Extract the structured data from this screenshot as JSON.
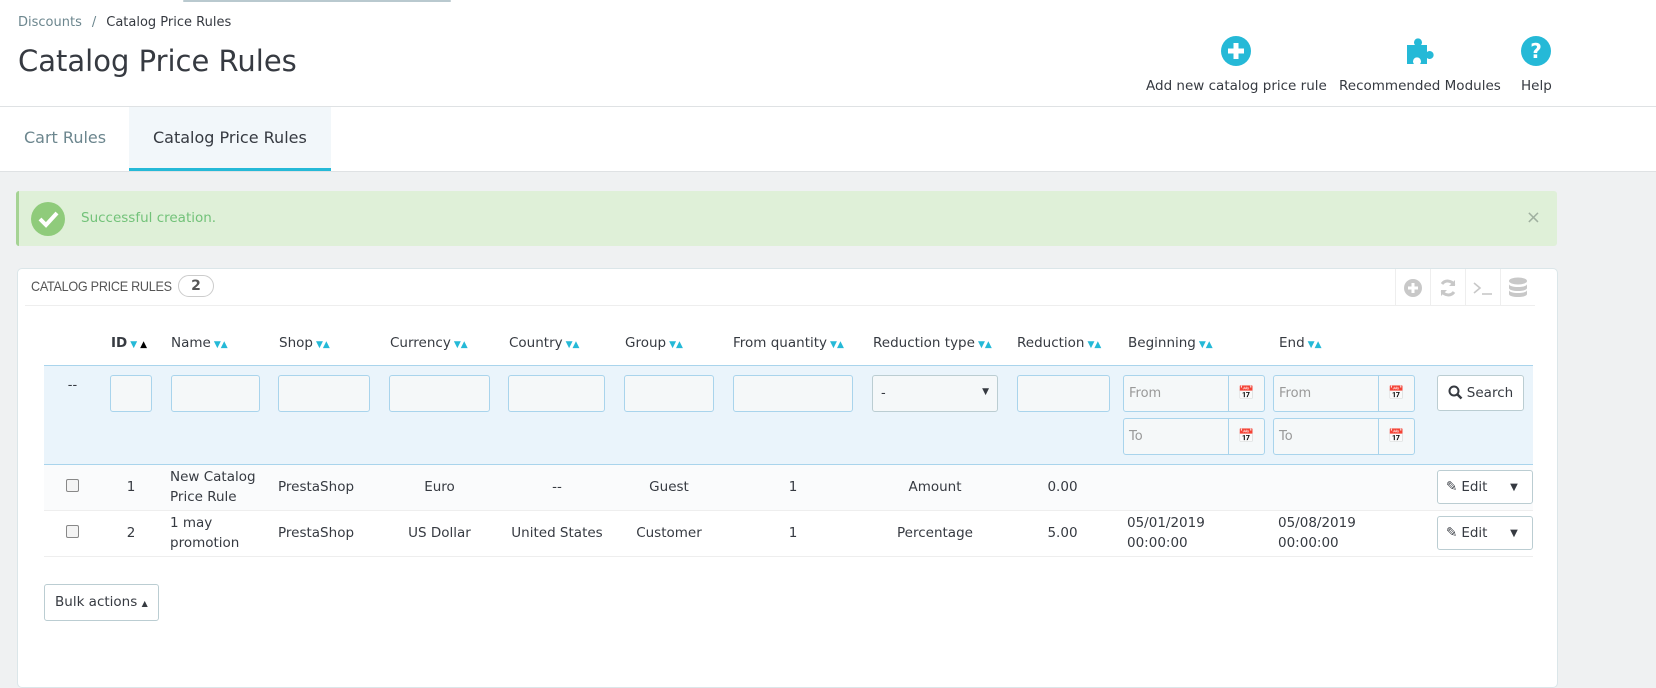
{
  "breadcrumb": {
    "parent": "Discounts",
    "separator": "/",
    "current": "Catalog Price Rules"
  },
  "page_title": "Catalog Price Rules",
  "toolbar": {
    "add": "Add new catalog price rule",
    "modules": "Recommended Modules",
    "help": "Help"
  },
  "tabs": [
    {
      "label": "Cart Rules"
    },
    {
      "label": "Catalog Price Rules",
      "active": true
    }
  ],
  "alert": {
    "message": "Successful creation.",
    "close": "×"
  },
  "panel": {
    "title": "CATALOG PRICE RULES",
    "count": "2"
  },
  "columns": [
    "ID",
    "Name",
    "Shop",
    "Currency",
    "Country",
    "Group",
    "From quantity",
    "Reduction type",
    "Reduction",
    "Beginning",
    "End"
  ],
  "filters": {
    "dash": "--",
    "reduction_type": "-",
    "from": "From",
    "to": "To",
    "search": "Search"
  },
  "rows": [
    {
      "id": "1",
      "name": "New Catalog Price Rule",
      "shop": "PrestaShop",
      "currency": "Euro",
      "country": "--",
      "group": "Guest",
      "from_quantity": "1",
      "reduction_type": "Amount",
      "reduction": "0.00",
      "beginning": "",
      "end": "",
      "action": "Edit"
    },
    {
      "id": "2",
      "name": "1 may promotion",
      "shop": "PrestaShop",
      "currency": "US Dollar",
      "country": "United States",
      "group": "Customer",
      "from_quantity": "1",
      "reduction_type": "Percentage",
      "reduction": "5.00",
      "beginning": "05/01/2019 00:00:00",
      "end": "05/08/2019 00:00:00",
      "action": "Edit"
    }
  ],
  "bulk_actions": "Bulk actions",
  "colors": {
    "accent": "#25b9d7",
    "success_bg": "#dff0d8",
    "success_text": "#72c279"
  }
}
